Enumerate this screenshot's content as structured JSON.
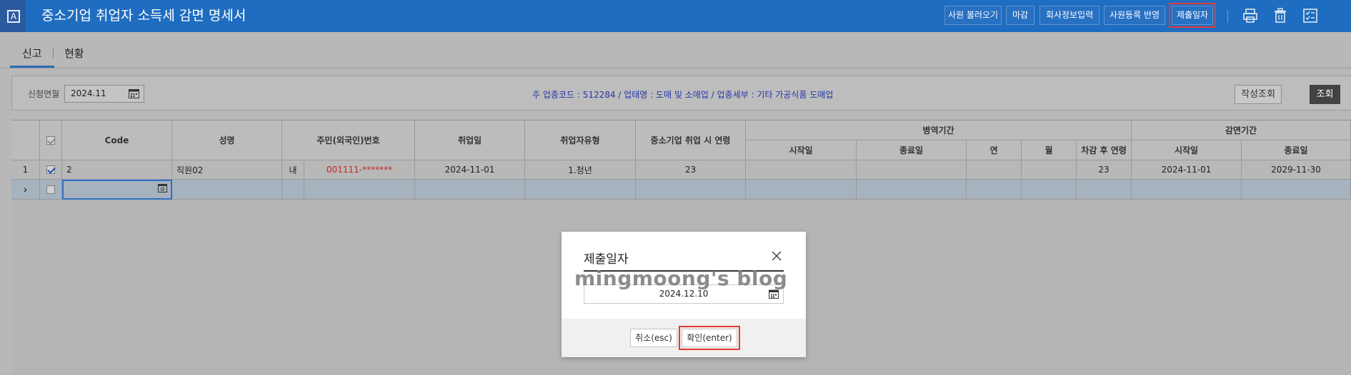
{
  "app": {
    "logo_letter": "A",
    "title": "중소기업 취업자 소득세 감면 명세서"
  },
  "toolbar": {
    "buttons": [
      {
        "label": "사원 불러오기"
      },
      {
        "label": "마감"
      },
      {
        "label": "회사정보입력"
      },
      {
        "label": "사원등록 반영"
      },
      {
        "label": "제출일자"
      }
    ],
    "icons": [
      "print-icon",
      "delete-icon",
      "checklist-icon"
    ]
  },
  "tabs": [
    {
      "label": "신고",
      "active": true
    },
    {
      "label": "현황",
      "active": false
    }
  ],
  "filter": {
    "period_label": "신청연월",
    "period_value": "2024.11",
    "business_info": "주 업종코드 : 512284 / 업태명 : 도매 및 소매업 / 업종세부 : 기타 가공식품 도매업",
    "write_query_label": "작성조회",
    "query_label": "조회"
  },
  "grid": {
    "headers": {
      "code": "Code",
      "name": "성명",
      "resident_no": "주민(외국인)번호",
      "hire_date": "취업일",
      "employee_type": "취업자유형",
      "age_at_hire": "중소기업 취업 시 연령",
      "military": "병역기간",
      "mil_start": "시작일",
      "mil_end": "종료일",
      "mil_year": "연",
      "mil_month": "월",
      "age_after": "차감 후 연령",
      "reduction": "감면기간",
      "red_start": "시작일",
      "red_end": "종료일"
    },
    "rows": [
      {
        "index": "1",
        "checked": true,
        "code": "2",
        "name": "직원02",
        "nationality": "내",
        "resident_no": "001111-*******",
        "hire_date": "2024-11-01",
        "employee_type": "1.청년",
        "age_at_hire": "23",
        "mil_start": "",
        "mil_end": "",
        "mil_year": "",
        "mil_month": "",
        "age_after": "23",
        "red_start": "2024-11-01",
        "red_end": "2029-11-30"
      }
    ],
    "new_row_marker": "›"
  },
  "dialog": {
    "title": "제출일자",
    "watermark": "mingmoong's blog",
    "date_value": "2024.12.10",
    "cancel_label": "취소(esc)",
    "confirm_label": "확인(enter)"
  },
  "colors": {
    "titlebar": "#1e6dc0",
    "highlight": "#e53935",
    "info_text": "#2636a8",
    "masked_id": "#c62828"
  }
}
